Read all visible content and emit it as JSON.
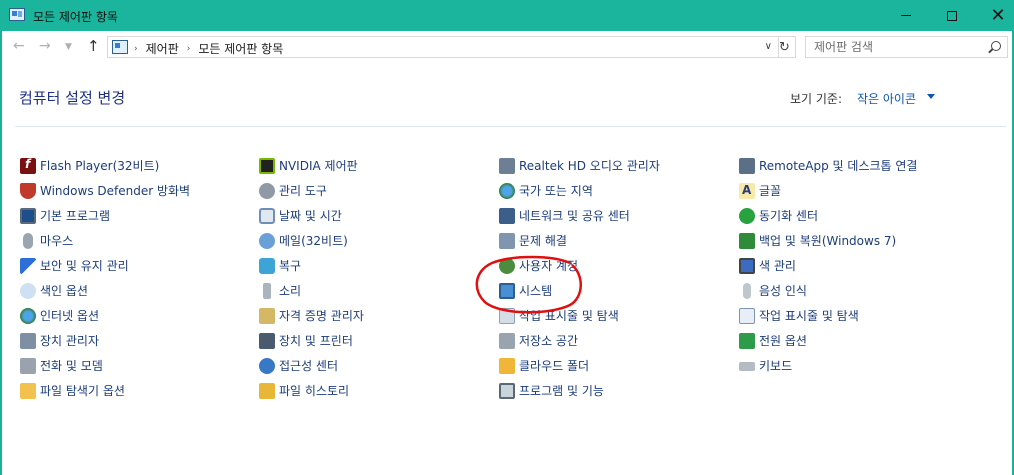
{
  "window": {
    "title": "모든 제어판 항목",
    "accent": "#1ab59c"
  },
  "nav": {
    "breadcrumbs": [
      "제어판",
      "모든 제어판 항목"
    ],
    "search_placeholder": "제어판 검색"
  },
  "header": {
    "title": "컴퓨터 설정 변경",
    "view_by_label": "보기 기준:",
    "view_by_value": "작은 아이콘"
  },
  "columns": [
    {
      "items": [
        {
          "label": "Flash Player(32비트)",
          "icon": "flash-player-icon"
        },
        {
          "label": "Windows Defender 방화벽",
          "icon": "firewall-icon"
        },
        {
          "label": "기본 프로그램",
          "icon": "default-programs-icon"
        },
        {
          "label": "마우스",
          "icon": "mouse-icon"
        },
        {
          "label": "보안 및 유지 관리",
          "icon": "security-flag-icon"
        },
        {
          "label": "색인 옵션",
          "icon": "indexing-icon"
        },
        {
          "label": "인터넷 옵션",
          "icon": "internet-options-icon"
        },
        {
          "label": "장치 관리자",
          "icon": "device-manager-icon"
        },
        {
          "label": "전화 및 모뎀",
          "icon": "phone-modem-icon"
        },
        {
          "label": "파일 탐색기 옵션",
          "icon": "folder-options-icon"
        }
      ]
    },
    {
      "items": [
        {
          "label": "NVIDIA 제어판",
          "icon": "nvidia-icon"
        },
        {
          "label": "관리 도구",
          "icon": "admin-tools-icon"
        },
        {
          "label": "날짜 및 시간",
          "icon": "date-time-icon"
        },
        {
          "label": "메일(32비트)",
          "icon": "mail-icon"
        },
        {
          "label": "복구",
          "icon": "recovery-icon"
        },
        {
          "label": "소리",
          "icon": "sound-icon"
        },
        {
          "label": "자격 증명 관리자",
          "icon": "credential-icon"
        },
        {
          "label": "장치 및 프린터",
          "icon": "printer-icon"
        },
        {
          "label": "접근성 센터",
          "icon": "accessibility-icon"
        },
        {
          "label": "파일 히스토리",
          "icon": "file-history-icon"
        }
      ]
    },
    {
      "items": [
        {
          "label": "Realtek HD 오디오 관리자",
          "icon": "realtek-audio-icon"
        },
        {
          "label": "국가 또는 지역",
          "icon": "region-icon"
        },
        {
          "label": "네트워크 및 공유 센터",
          "icon": "network-icon"
        },
        {
          "label": "문제 해결",
          "icon": "troubleshoot-icon"
        },
        {
          "label": "사용자 계정",
          "icon": "user-accounts-icon"
        },
        {
          "label": "시스템",
          "icon": "system-icon"
        },
        {
          "label": "작업 표시줄 및 탐색",
          "icon": "taskbar-icon"
        },
        {
          "label": "저장소 공간",
          "icon": "storage-icon"
        },
        {
          "label": "클라우드 폴더",
          "icon": "cloud-folder-icon"
        },
        {
          "label": "프로그램 및 기능",
          "icon": "programs-icon"
        }
      ]
    },
    {
      "items": [
        {
          "label": "RemoteApp 및 데스크톱 연결",
          "icon": "remoteapp-icon"
        },
        {
          "label": "글꼴",
          "icon": "font-icon"
        },
        {
          "label": "동기화 센터",
          "icon": "sync-icon"
        },
        {
          "label": "백업 및 복원(Windows 7)",
          "icon": "backup-icon"
        },
        {
          "label": "색 관리",
          "icon": "color-management-icon"
        },
        {
          "label": "음성 인식",
          "icon": "speech-icon"
        },
        {
          "label": "작업 표시줄 및 탐색",
          "icon": "taskbar-nav-icon"
        },
        {
          "label": "전원 옵션",
          "icon": "power-icon"
        },
        {
          "label": "키보드",
          "icon": "keyboard-icon"
        }
      ]
    }
  ]
}
